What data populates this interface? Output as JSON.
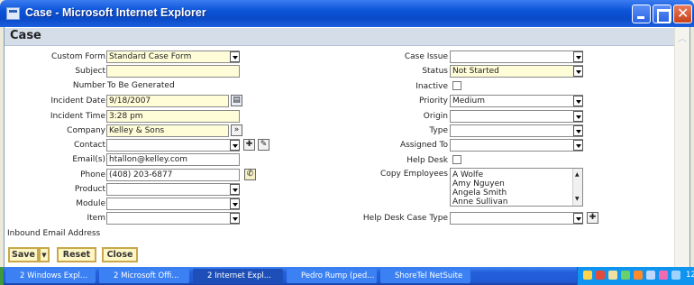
{
  "window": {
    "title": "Case - Microsoft Internet Explorer"
  },
  "page": {
    "heading": "Case"
  },
  "left": {
    "custom_form": {
      "label": "Custom Form",
      "value": "Standard Case Form"
    },
    "subject": {
      "label": "Subject",
      "value": ""
    },
    "number": {
      "label": "Number",
      "value": "To Be Generated"
    },
    "incident_date": {
      "label": "Incident Date",
      "value": "9/18/2007"
    },
    "incident_time": {
      "label": "Incident Time",
      "value": "3:28 pm"
    },
    "company": {
      "label": "Company",
      "value": "Kelley & Sons"
    },
    "contact": {
      "label": "Contact",
      "value": ""
    },
    "email": {
      "label": "Email(s)",
      "value": "htallon@kelley.com"
    },
    "phone": {
      "label": "Phone",
      "value": "(408) 203-6877"
    },
    "product": {
      "label": "Product",
      "value": ""
    },
    "module": {
      "label": "Module",
      "value": ""
    },
    "item": {
      "label": "Item",
      "value": ""
    },
    "inbound_email": {
      "label": "Inbound Email Address"
    }
  },
  "right": {
    "case_issue": {
      "label": "Case Issue",
      "value": ""
    },
    "status": {
      "label": "Status",
      "value": "Not Started"
    },
    "inactive": {
      "label": "Inactive",
      "checked": false
    },
    "priority": {
      "label": "Priority",
      "value": "Medium"
    },
    "origin": {
      "label": "Origin",
      "value": ""
    },
    "type": {
      "label": "Type",
      "value": ""
    },
    "assigned_to": {
      "label": "Assigned To",
      "value": ""
    },
    "help_desk": {
      "label": "Help Desk",
      "checked": false
    },
    "copy_employees": {
      "label": "Copy Employees",
      "options": [
        "A Wolfe",
        "Amy Nguyen",
        "Angela Smith",
        "Anne Sullivan"
      ]
    },
    "help_desk_case_type": {
      "label": "Help Desk Case Type",
      "value": ""
    }
  },
  "buttons": {
    "save": "Save",
    "reset": "Reset",
    "close": "Close"
  },
  "taskbar": {
    "items": [
      "2 Windows Expl...",
      "2 Microsoft Offi...",
      "2 Internet Expl...",
      "Pedro Rump (ped...",
      "ShoreTel NetSuite"
    ],
    "clock": "12"
  },
  "colors": {
    "required_field": "#fffdd8",
    "header_band": "#d5dde8",
    "button_fill": "#fff6c6"
  }
}
